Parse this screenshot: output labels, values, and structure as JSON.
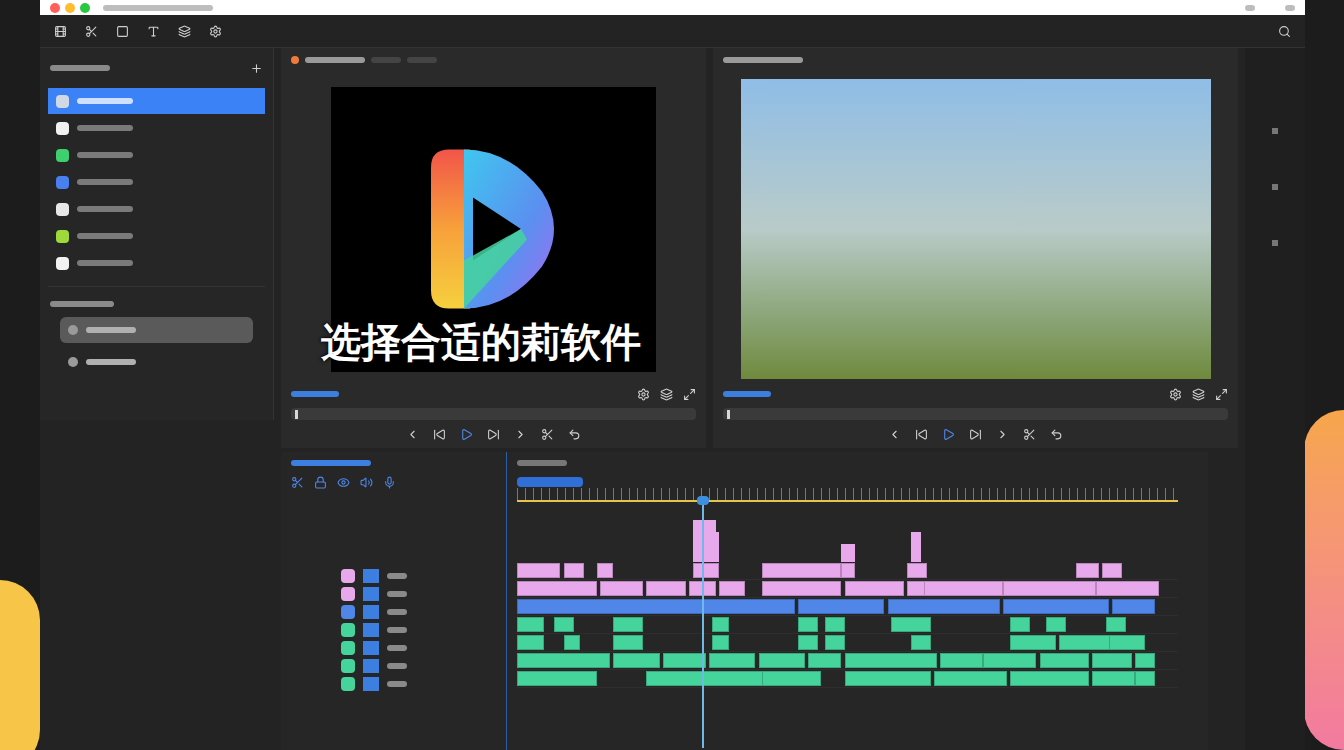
{
  "window": {
    "traffic_lights": [
      "#ff5f57",
      "#febc2e",
      "#28c840"
    ]
  },
  "sidebar": {
    "items": [
      {
        "selected": true,
        "color": "#cfd8e3"
      },
      {
        "selected": false,
        "color": "#f2f2f2"
      },
      {
        "selected": false,
        "color": "#3ecf6e"
      },
      {
        "selected": false,
        "color": "#4a7ff0"
      },
      {
        "selected": false,
        "color": "#e8e8e8"
      },
      {
        "selected": false,
        "color": "#9fd83a"
      },
      {
        "selected": false,
        "color": "#f2f2f2"
      }
    ],
    "bins": [
      {
        "selected": true
      },
      {
        "selected": false
      }
    ]
  },
  "caption": "选择合适的莉软件",
  "source_monitor": {
    "content": "logo"
  },
  "program_monitor": {
    "content": "photo"
  },
  "timeline": {
    "playhead": {
      "level": 0.28
    },
    "peaks": [
      {
        "start": 26.5,
        "length": 3.5,
        "height": 42
      },
      {
        "start": 29,
        "length": 1.5,
        "height": 30
      },
      {
        "start": 49,
        "length": 2,
        "height": 18
      },
      {
        "start": 59.5,
        "length": 1.5,
        "height": 30
      }
    ],
    "tracks": [
      {
        "color": "#e8a8ec",
        "clips": [
          [
            0,
            6.5
          ],
          [
            7,
            3
          ],
          [
            12,
            2.5
          ],
          [
            26.5,
            4
          ],
          [
            37,
            12
          ],
          [
            49,
            2
          ],
          [
            59,
            3
          ],
          [
            84.5,
            3.5
          ],
          [
            88.5,
            3
          ]
        ]
      },
      {
        "color": "#e8a8ec",
        "clips": [
          [
            0,
            12
          ],
          [
            12.5,
            6.5
          ],
          [
            19.5,
            6
          ],
          [
            26,
            4
          ],
          [
            30.5,
            4
          ],
          [
            37,
            12
          ],
          [
            49.5,
            9
          ],
          [
            59,
            3
          ],
          [
            61.5,
            12
          ],
          [
            73.5,
            14
          ],
          [
            87.5,
            9.5
          ]
        ]
      },
      {
        "color": "#4f86e8",
        "clips": [
          [
            0,
            42
          ],
          [
            42.5,
            13
          ],
          [
            56,
            17
          ],
          [
            73.5,
            16
          ],
          [
            90,
            6.5
          ]
        ]
      },
      {
        "color": "#45d49c",
        "clips": [
          [
            0,
            4
          ],
          [
            5.5,
            3
          ],
          [
            14.5,
            4.5
          ],
          [
            29.5,
            2.5
          ],
          [
            42.5,
            3
          ],
          [
            46.5,
            3
          ],
          [
            56.5,
            6
          ],
          [
            74.5,
            3
          ],
          [
            80,
            3
          ],
          [
            89,
            3
          ]
        ]
      },
      {
        "color": "#45d49c",
        "clips": [
          [
            0,
            4
          ],
          [
            7,
            2.5
          ],
          [
            14.5,
            4.5
          ],
          [
            29.5,
            2.5
          ],
          [
            42.5,
            3
          ],
          [
            46.5,
            3
          ],
          [
            59.5,
            3
          ],
          [
            74.5,
            7
          ],
          [
            82,
            9.5
          ],
          [
            89.5,
            5.5
          ]
        ]
      },
      {
        "color": "#45d49c",
        "clips": [
          [
            0,
            14
          ],
          [
            14.5,
            7
          ],
          [
            22,
            6.5
          ],
          [
            29,
            7
          ],
          [
            36.5,
            7
          ],
          [
            44,
            5
          ],
          [
            49.5,
            14
          ],
          [
            64,
            6.5
          ],
          [
            70.5,
            8
          ],
          [
            79,
            7.5
          ],
          [
            87,
            6
          ],
          [
            93.5,
            3
          ]
        ]
      },
      {
        "color": "#45d49c",
        "clips": [
          [
            0,
            12
          ],
          [
            19.5,
            18
          ],
          [
            37,
            9
          ],
          [
            49.5,
            13
          ],
          [
            63,
            11
          ],
          [
            74.5,
            12
          ],
          [
            87,
            6.5
          ],
          [
            93.5,
            3
          ]
        ]
      }
    ]
  }
}
